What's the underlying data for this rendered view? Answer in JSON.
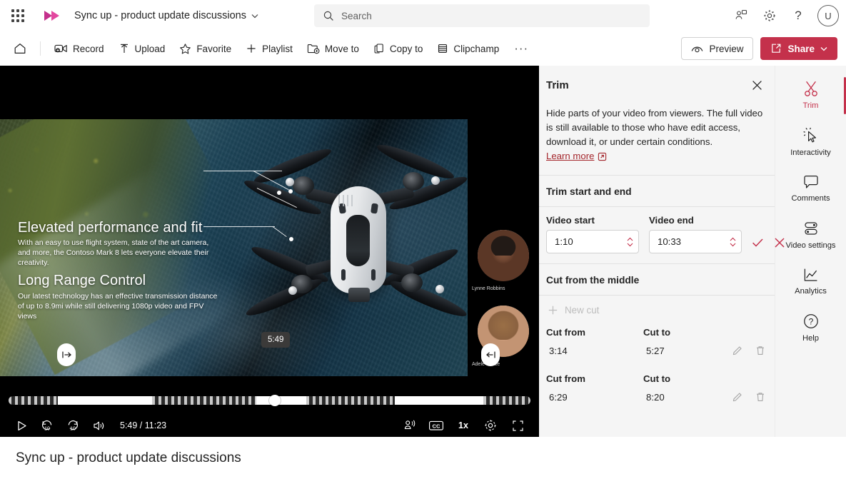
{
  "header": {
    "waffle_label": "app-launcher",
    "app_name": "Stream",
    "doc_title": "Sync up - product update discussions",
    "search_placeholder": "Search",
    "icons": [
      "meet-now-icon",
      "gear-icon",
      "help-icon"
    ],
    "avatar_initial": "U"
  },
  "commandbar": {
    "home_label": "Home",
    "items": [
      {
        "label": "Record",
        "icon": "record-icon"
      },
      {
        "label": "Upload",
        "icon": "upload-icon"
      },
      {
        "label": "Favorite",
        "icon": "star-icon"
      },
      {
        "label": "Playlist",
        "icon": "plus-icon"
      },
      {
        "label": "Move to",
        "icon": "move-folder-icon"
      },
      {
        "label": "Copy to",
        "icon": "copy-icon"
      },
      {
        "label": "Clipchamp",
        "icon": "clipchamp-icon"
      }
    ],
    "overflow_label": "···",
    "preview_label": "Preview",
    "share_label": "Share"
  },
  "player": {
    "overlay": {
      "heading1": "Elevated performance and fit",
      "body1": "With an easy to use flight system, state of the art camera, and more, the Contoso Mark 8 lets everyone elevate their creativity.",
      "heading2": "Long Range Control",
      "body2": "Our latest technology has an effective transmission distance of up to 8.9mi while still delivering 1080p video and FPV views"
    },
    "people": [
      {
        "name": "Lynne Robbins"
      },
      {
        "name": "Adele Vance"
      }
    ],
    "tooltip_time": "5:49",
    "current_time": "5:49",
    "total_time": "11:23",
    "time_display": "5:49 / 11:23",
    "rewind_label": "10",
    "forward_label": "10",
    "speed_label": "1x",
    "cc_label": "CC",
    "progress_percent": 51,
    "trim_start_percent": 9.5,
    "trim_end_percent": 91,
    "timeline_segments": [
      {
        "type": "dots",
        "start": 0,
        "end": 9.5
      },
      {
        "type": "full",
        "start": 9.5,
        "end": 27.5
      },
      {
        "type": "dots",
        "start": 27.5,
        "end": 47.5
      },
      {
        "type": "full",
        "start": 47.5,
        "end": 57
      },
      {
        "type": "dots",
        "start": 57,
        "end": 74
      },
      {
        "type": "full",
        "start": 74,
        "end": 91
      },
      {
        "type": "dots",
        "start": 91,
        "end": 100
      }
    ]
  },
  "trim_panel": {
    "title": "Trim",
    "close_label": "×",
    "description": "Hide parts of your video from viewers. The full video is still available to those who have edit access, download it, or under certain conditions.",
    "learn_more": "Learn more",
    "section_start_end": "Trim start and end",
    "video_start_label": "Video start",
    "video_start_value": "1:10",
    "video_end_label": "Video end",
    "video_end_value": "10:33",
    "confirm_label": "✓",
    "cancel_label": "×",
    "section_middle": "Cut from the middle",
    "new_cut_label": "New cut",
    "cut_from_label": "Cut from",
    "cut_to_label": "Cut to",
    "cuts": [
      {
        "from": "3:14",
        "to": "5:27"
      },
      {
        "from": "6:29",
        "to": "8:20"
      }
    ]
  },
  "rail": {
    "items": [
      {
        "label": "Trim",
        "icon": "scissors-icon",
        "active": true
      },
      {
        "label": "Interactivity",
        "icon": "cursor-click-icon",
        "active": false
      },
      {
        "label": "Comments",
        "icon": "comment-bubble-icon",
        "active": false
      },
      {
        "label": "Video settings",
        "icon": "toggles-icon",
        "active": false
      },
      {
        "label": "Analytics",
        "icon": "chart-line-icon",
        "active": false
      },
      {
        "label": "Help",
        "icon": "question-circle-icon",
        "active": false
      }
    ]
  },
  "footer": {
    "video_title": "Sync up - product update discussions"
  },
  "colors": {
    "accent": "#c4314b",
    "link": "#a4262c",
    "panel_bg": "#f5f5f5",
    "text": "#242424"
  }
}
